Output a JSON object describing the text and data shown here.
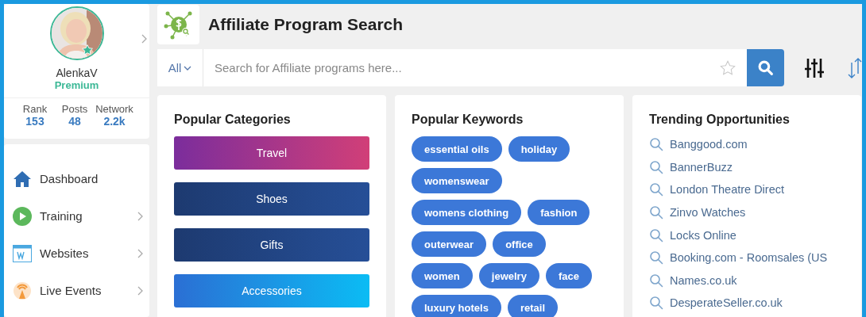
{
  "profile": {
    "name": "AlenkaV",
    "plan": "Premium",
    "stats": [
      {
        "label": "Rank",
        "value": "153"
      },
      {
        "label": "Posts",
        "value": "48"
      },
      {
        "label": "Network",
        "value": "2.2k"
      }
    ]
  },
  "sidebar": {
    "items": [
      {
        "label": "Dashboard",
        "kind": "home",
        "expandable": false
      },
      {
        "label": "Training",
        "kind": "play",
        "expandable": true
      },
      {
        "label": "Websites",
        "kind": "website",
        "expandable": true
      },
      {
        "label": "Live Events",
        "kind": "broadcast",
        "expandable": true
      }
    ]
  },
  "header": {
    "title": "Affiliate Program Search"
  },
  "search": {
    "scope": "All",
    "placeholder": "Search for Affiliate programs here..."
  },
  "categories": {
    "title": "Popular Categories",
    "items": [
      {
        "label": "Travel",
        "kind": "violet"
      },
      {
        "label": "Shoes",
        "kind": "navy"
      },
      {
        "label": "Gifts",
        "kind": "navy"
      },
      {
        "label": "Accessories",
        "kind": "azure"
      }
    ]
  },
  "keywords": {
    "title": "Popular Keywords",
    "items": [
      "essential oils",
      "holiday",
      "womenswear",
      "womens clothing",
      "fashion",
      "outerwear",
      "office",
      "women",
      "jewelry",
      "face",
      "luxury hotels",
      "retail"
    ]
  },
  "trending": {
    "title": "Trending Opportunities",
    "items": [
      "Banggood.com",
      "BannerBuzz",
      "London Theatre Direct",
      "Zinvo Watches",
      "Locks Online",
      "Booking.com - Roomsales (US",
      "Names.co.uk",
      "DesperateSeller.co.uk"
    ]
  }
}
